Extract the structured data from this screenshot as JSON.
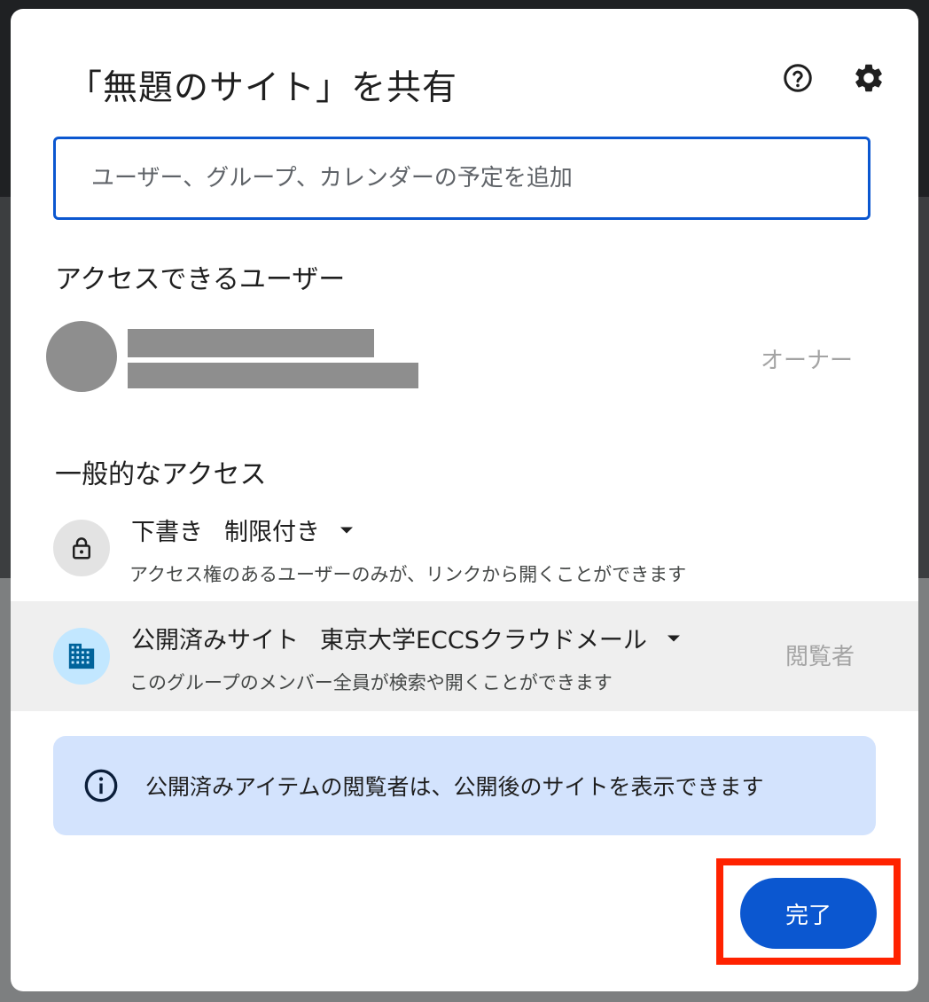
{
  "dialog": {
    "title": "「無題のサイト」を共有",
    "help_icon": "help-icon",
    "settings_icon": "gear-icon"
  },
  "search": {
    "placeholder": "ユーザー、グループ、カレンダーの予定を追加",
    "value": ""
  },
  "people_access": {
    "heading": "アクセスできるユーザー",
    "users": [
      {
        "name": "",
        "email": "",
        "role": "オーナー"
      }
    ]
  },
  "general_access": {
    "heading": "一般的なアクセス",
    "draft": {
      "label": "下書き",
      "setting": "制限付き",
      "description": "アクセス権のあるユーザーのみが、リンクから開くことができます",
      "icon": "lock-icon"
    },
    "published": {
      "label": "公開済みサイト",
      "setting": "東京大学ECCSクラウドメール",
      "description": "このグループのメンバー全員が検索や開くことができます",
      "role": "閲覧者",
      "icon": "domain-icon"
    }
  },
  "info": {
    "text": "公開済みアイテムの閲覧者は、公開後のサイトを表示できます",
    "icon": "info-icon"
  },
  "footer": {
    "done_label": "完了"
  },
  "colors": {
    "primary": "#0b57d0",
    "info_background": "#d3e3fd",
    "highlight": "#ff2200",
    "domain_icon_background": "#c2e7ff"
  }
}
